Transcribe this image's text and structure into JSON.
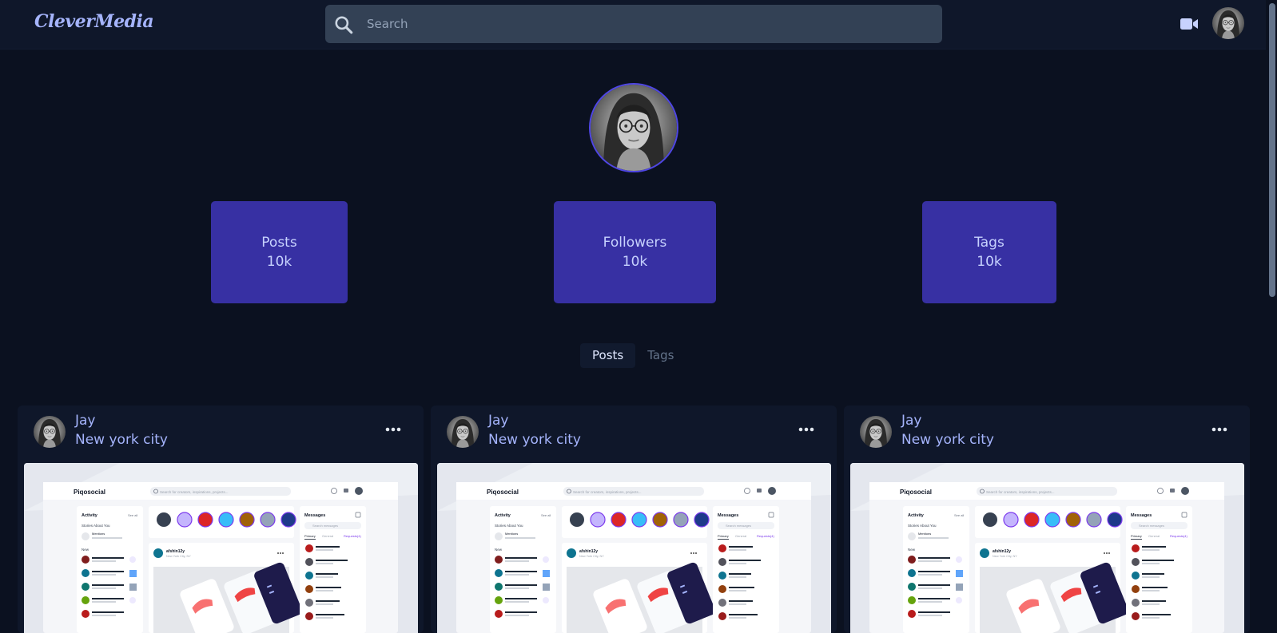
{
  "app": {
    "logo": "CleverMedia"
  },
  "search": {
    "placeholder": "Search"
  },
  "stats": [
    {
      "label": "Posts",
      "value": "10k"
    },
    {
      "label": "Followers",
      "value": "10k"
    },
    {
      "label": "Tags",
      "value": "10k"
    }
  ],
  "tabs": [
    {
      "label": "Posts",
      "active": true
    },
    {
      "label": "Tags",
      "active": false
    }
  ],
  "posts": [
    {
      "author": "Jay",
      "location": "New york city",
      "preview": {
        "brand": "Piqosocial",
        "search_placeholder": "Search for creators, inspirations, projects...",
        "activity_title": "Activity",
        "see_all": "See all",
        "stories_title": "Stories About You",
        "mentions": "Mentions",
        "new_label": "New",
        "messages_title": "Messages",
        "msg_search": "Search messages",
        "msg_tabs": [
          "Primary",
          "General",
          "Requests(4)"
        ],
        "post_user": "afshin12y",
        "post_loc": "New York City, NY"
      }
    },
    {
      "author": "Jay",
      "location": "New york city",
      "preview": {
        "brand": "Piqosocial",
        "search_placeholder": "Search for creators, inspirations, projects...",
        "activity_title": "Activity",
        "see_all": "See all",
        "stories_title": "Stories About You",
        "mentions": "Mentions",
        "new_label": "New",
        "messages_title": "Messages",
        "msg_search": "Search messages",
        "msg_tabs": [
          "Primary",
          "General",
          "Requests(4)"
        ],
        "post_user": "afshin12y",
        "post_loc": "New York City, NY"
      }
    },
    {
      "author": "Jay",
      "location": "New york city",
      "preview": {
        "brand": "Piqosocial",
        "search_placeholder": "Search for creators, inspirations, projects...",
        "activity_title": "Activity",
        "see_all": "See all",
        "stories_title": "Stories About You",
        "mentions": "Mentions",
        "new_label": "New",
        "messages_title": "Messages",
        "msg_search": "Search messages",
        "msg_tabs": [
          "Primary",
          "General",
          "Requests(4)"
        ],
        "post_user": "afshin12y",
        "post_loc": "New York City, NY"
      }
    }
  ],
  "colors": {
    "background": "#0b1120",
    "header": "#0f172a",
    "accent": "#3730a3",
    "text": "#c7d2fe"
  },
  "icons": [
    "search-icon",
    "video-camera-icon",
    "more-horizontal-icon"
  ]
}
